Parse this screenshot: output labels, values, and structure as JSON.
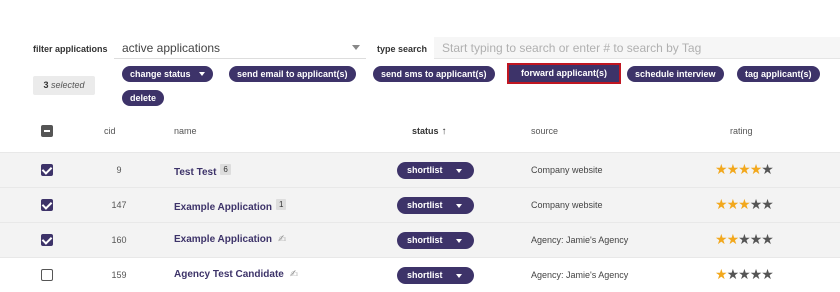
{
  "filters": {
    "filter_label": "filter applications",
    "filter_value": "active applications",
    "search_label": "type search",
    "search_placeholder": "Start typing to search or enter # to search by Tag"
  },
  "selection": {
    "count": "3",
    "suffix": "selected"
  },
  "actions": {
    "change_status": "change status",
    "send_email": "send email to applicant(s)",
    "send_sms": "send sms to applicant(s)",
    "forward": "forward applicant(s)",
    "schedule": "schedule interview",
    "tag": "tag applicant(s)",
    "delete": "delete"
  },
  "columns": {
    "cid": "cid",
    "name": "name",
    "status": "status",
    "status_sort_icon": "arrow-up-icon",
    "source": "source",
    "rating": "rating"
  },
  "colors": {
    "brand": "#3d3369",
    "star_on": "#f2a81d",
    "star_off": "#555555",
    "highlight": "#c01622"
  },
  "rows": [
    {
      "checked": true,
      "cid": "9",
      "name": "Test Test",
      "count": "6",
      "signed": false,
      "status": "shortlist",
      "source": "Company website",
      "rating": 4
    },
    {
      "checked": true,
      "cid": "147",
      "name": "Example Application",
      "count": "1",
      "signed": false,
      "status": "shortlist",
      "source": "Company website",
      "rating": 3
    },
    {
      "checked": true,
      "cid": "160",
      "name": "Example Application",
      "count": "",
      "signed": true,
      "status": "shortlist",
      "source": "Agency: Jamie's Agency",
      "rating": 2
    },
    {
      "checked": false,
      "cid": "159",
      "name": "Agency Test Candidate",
      "count": "",
      "signed": true,
      "status": "shortlist",
      "source": "Agency: Jamie's Agency",
      "rating": 1
    }
  ]
}
